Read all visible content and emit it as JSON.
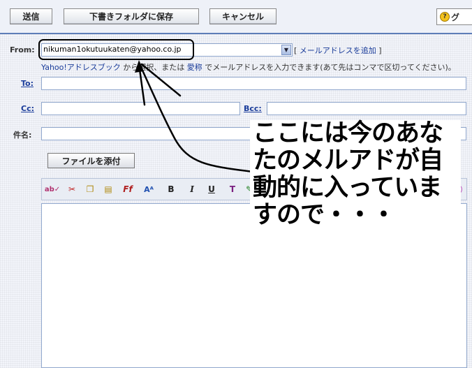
{
  "toolbar": {
    "send_label": "送信",
    "save_draft_label": "下書きフォルダに保存",
    "cancel_label": "キャンセル",
    "help_label": "グ"
  },
  "form": {
    "from_label": "From:",
    "from_value": "nikuman1okutuukaten@yahoo.co.jp",
    "add_address_label": "メールアドレスを追加",
    "hint_link1": "Yahoo!アドレスブック",
    "hint_mid1": "から選択、または",
    "hint_link2": "愛称",
    "hint_rest": "でメールアドレスを入力できます(あて先はコンマで区切ってください)。",
    "to_label": "To:",
    "cc_label": "Cc:",
    "bcc_label": "Bcc:",
    "subject_label": "件名:",
    "attach_label": "ファイルを添付"
  },
  "editor_toolbar": {
    "bold": "B",
    "italic": "I",
    "underline": "U"
  },
  "annotation": {
    "text": "ここには今のあなたのメルアドが自動的に入っていますので・・・"
  }
}
